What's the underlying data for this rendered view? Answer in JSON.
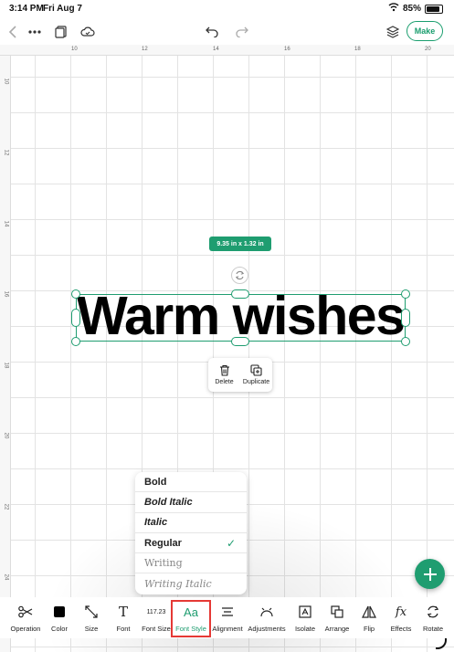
{
  "status": {
    "time": "3:14 PM",
    "date": "Fri Aug 7",
    "battery": "85%",
    "battery_level": 0.85
  },
  "topbar": {
    "make_label": "Make"
  },
  "ruler": {
    "top_ticks": [
      "10",
      "12",
      "14",
      "16",
      "18",
      "20"
    ],
    "left_ticks": [
      "10",
      "12",
      "14",
      "16",
      "18",
      "20",
      "22",
      "24"
    ]
  },
  "canvas": {
    "size_badge": "9.35 in x 1.32 in",
    "text": "Warm wishes"
  },
  "action_popup": {
    "delete_label": "Delete",
    "duplicate_label": "Duplicate"
  },
  "font_style_menu": {
    "items": [
      {
        "label": "Bold",
        "selected": false
      },
      {
        "label": "Bold Italic",
        "selected": false
      },
      {
        "label": "Italic",
        "selected": false
      },
      {
        "label": "Regular",
        "selected": true
      },
      {
        "label": "Writing",
        "selected": false
      },
      {
        "label": "Writing Italic",
        "selected": false
      }
    ]
  },
  "toolbar": {
    "font_size_value": "117.23",
    "font_style_icon_text": "Aa",
    "font_icon_text": "T",
    "tools": [
      {
        "label": "Operation"
      },
      {
        "label": "Color"
      },
      {
        "label": "Size"
      },
      {
        "label": "Font"
      },
      {
        "label": "Font Size"
      },
      {
        "label": "Font Style"
      },
      {
        "label": "Alignment"
      },
      {
        "label": "Adjustments"
      },
      {
        "label": "Isolate"
      },
      {
        "label": "Arrange"
      },
      {
        "label": "Flip"
      },
      {
        "label": "Effects"
      },
      {
        "label": "Rotate"
      }
    ]
  },
  "colors": {
    "accent": "#1f9d70",
    "highlight": "#e53935"
  }
}
